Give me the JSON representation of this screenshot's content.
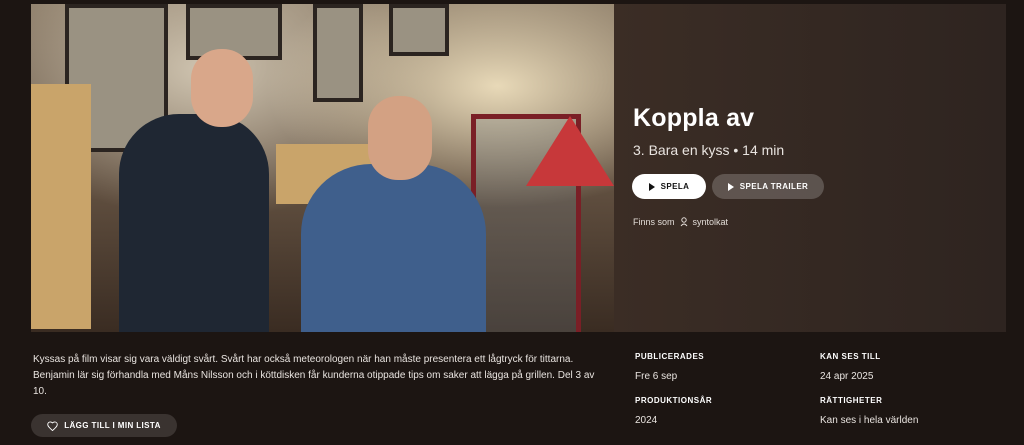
{
  "hero": {
    "title": "Koppla av",
    "episode": "3. Bara en kyss • 14 min",
    "play_label": "SPELA",
    "trailer_label": "SPELA TRAILER",
    "available_as_label": "Finns som",
    "available_as_value": "syntolkat",
    "available_as_icon": "audio-description-icon"
  },
  "description": "Kyssas på film visar sig vara väldigt svårt. Svårt har också meteorologen när han måste presentera ett lågtryck för tittarna. Benjamin lär sig förhandla med Måns Nilsson och i köttdisken får kunderna otippade tips om saker att lägga på grillen. Del 3 av 10.",
  "add_to_list_label": "LÄGG TILL I MIN LISTA",
  "meta": {
    "published_label": "PUBLICERADES",
    "published_value": "Fre 6 sep",
    "available_until_label": "KAN SES TILL",
    "available_until_value": "24 apr 2025",
    "production_year_label": "PRODUKTIONSÅR",
    "production_year_value": "2024",
    "rights_label": "RÄTTIGHETER",
    "rights_value": "Kan ses i hela världen"
  },
  "colors": {
    "background": "#1c1512",
    "accent_button": "#ffffff",
    "secondary_button": "#3a3330"
  }
}
